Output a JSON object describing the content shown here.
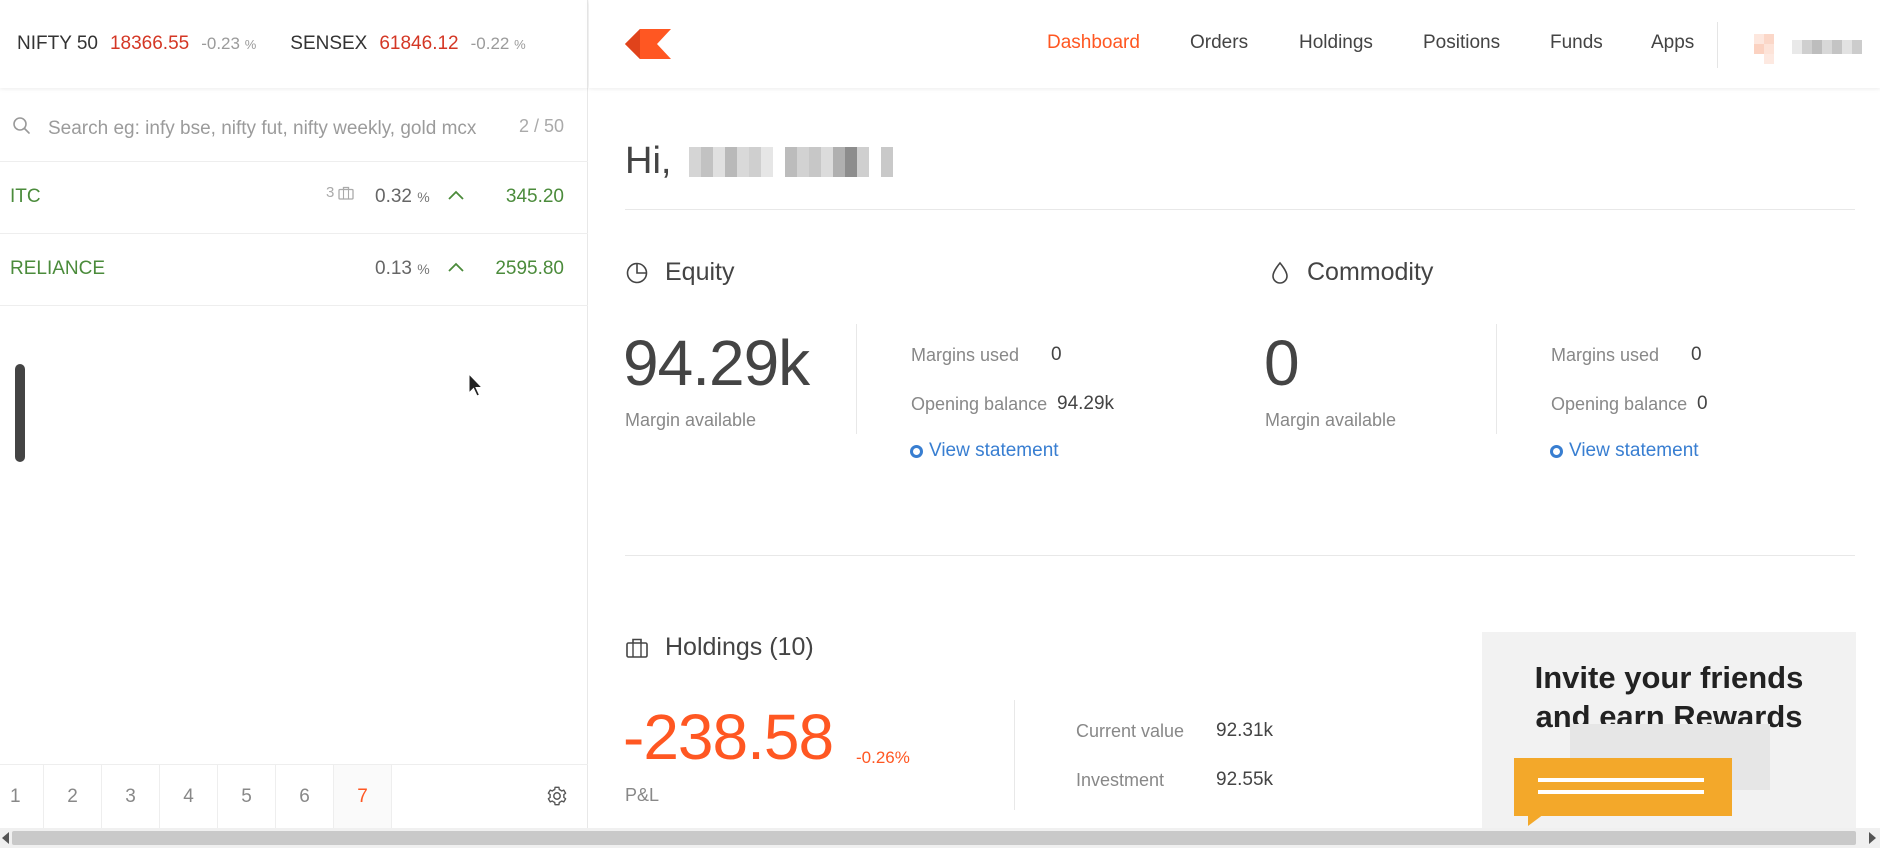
{
  "indices": [
    {
      "name": "NIFTY 50",
      "value": "18366.55",
      "change": "-0.23",
      "unit": "%"
    },
    {
      "name": "SENSEX",
      "value": "61846.12",
      "change": "-0.22",
      "unit": "%"
    }
  ],
  "search": {
    "placeholder": "Search eg: infy bse, nifty fut, nifty weekly, gold mcx",
    "count": "2 / 50"
  },
  "watchlist": [
    {
      "symbol": "ITC",
      "qty": "3",
      "change": "0.32",
      "unit": "%",
      "price": "345.20"
    },
    {
      "symbol": "RELIANCE",
      "qty": "",
      "change": "0.13",
      "unit": "%",
      "price": "2595.80"
    }
  ],
  "pages": [
    "1",
    "2",
    "3",
    "4",
    "5",
    "6",
    "7"
  ],
  "active_page": "7",
  "nav": {
    "items": [
      "Dashboard",
      "Orders",
      "Holdings",
      "Positions",
      "Funds",
      "Apps"
    ],
    "active": "Dashboard"
  },
  "greeting": {
    "label": "Hi,"
  },
  "equity": {
    "title": "Equity",
    "margin_available": "94.29k",
    "margin_available_label": "Margin available",
    "margins_used_label": "Margins used",
    "margins_used": "0",
    "opening_balance_label": "Opening balance",
    "opening_balance": "94.29k",
    "view_statement": "View statement"
  },
  "commodity": {
    "title": "Commodity",
    "margin_available": "0",
    "margin_available_label": "Margin available",
    "margins_used_label": "Margins used",
    "margins_used": "0",
    "opening_balance_label": "Opening balance",
    "opening_balance": "0",
    "view_statement": "View statement"
  },
  "holdings": {
    "title": "Holdings (10)",
    "pnl": "-238.58",
    "pnl_pct": "-0.26%",
    "pnl_label": "P&L",
    "current_value_label": "Current value",
    "current_value": "92.31k",
    "investment_label": "Investment",
    "investment": "92.55k"
  },
  "promo": {
    "line1": "Invite your friends",
    "line2": "and earn Rewards"
  },
  "colors": {
    "accent": "#ff5722",
    "negative": "#d43725",
    "positive": "#4b8b3b",
    "link": "#387ed1"
  }
}
